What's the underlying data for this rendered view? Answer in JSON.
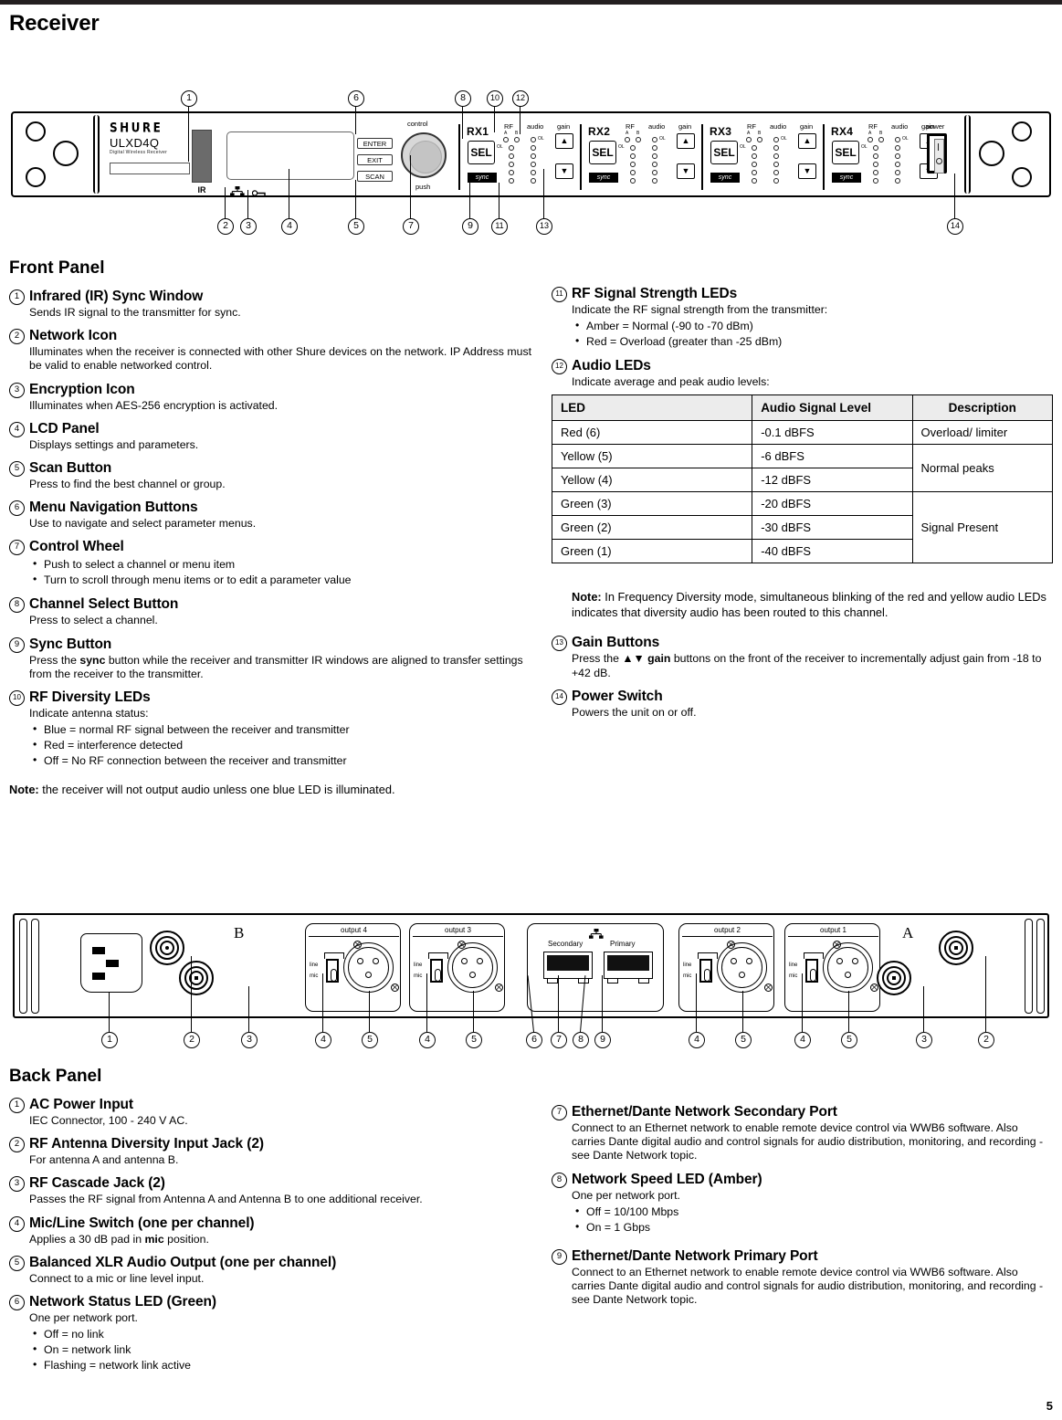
{
  "page": {
    "title": "Receiver",
    "number": "5"
  },
  "front_diagram": {
    "brand": "SHURE",
    "model": "ULXD4Q",
    "subtitle": "Digital Wireless Receiver",
    "ir_label": "IR",
    "control_label": "control",
    "push_label": "push",
    "menu_buttons": [
      "ENTER",
      "EXIT",
      "SCAN"
    ],
    "channels": [
      {
        "name": "RX1",
        "sel": "SEL",
        "sync": "sync"
      },
      {
        "name": "RX2",
        "sel": "SEL",
        "sync": "sync"
      },
      {
        "name": "RX3",
        "sel": "SEL",
        "sync": "sync"
      },
      {
        "name": "RX4",
        "sel": "SEL",
        "sync": "sync"
      }
    ],
    "group_labels": {
      "rf": "RF",
      "audio": "audio",
      "gain": "gain",
      "a": "A",
      "b": "B",
      "ol": "OL"
    },
    "power_label": "power",
    "callouts_top": [
      "1",
      "6",
      "8",
      "10",
      "12"
    ],
    "callouts_bottom": [
      "2",
      "3",
      "4",
      "5",
      "7",
      "9",
      "11",
      "13",
      "14"
    ]
  },
  "front_panel": {
    "heading": "Front Panel",
    "items_left": [
      {
        "num": "1",
        "title": "Infrared (IR) Sync Window",
        "body": "Sends IR signal to the transmitter for sync."
      },
      {
        "num": "2",
        "title": "Network Icon",
        "body": "Illuminates when the receiver is connected with other Shure devices on the network. IP Address must be valid to enable networked control."
      },
      {
        "num": "3",
        "title": "Encryption Icon",
        "body": "Illuminates when AES-256 encryption is activated."
      },
      {
        "num": "4",
        "title": "LCD Panel",
        "body": "Displays settings and parameters."
      },
      {
        "num": "5",
        "title": "Scan Button",
        "body": "Press to find the best channel or group."
      },
      {
        "num": "6",
        "title": "Menu Navigation Buttons",
        "body": "Use to navigate and select parameter menus."
      },
      {
        "num": "7",
        "title": "Control Wheel",
        "bullets": [
          "Push to select a channel or menu item",
          "Turn to scroll through menu items or to edit a parameter value"
        ]
      },
      {
        "num": "8",
        "title": "Channel Select Button",
        "body": "Press to select a channel."
      },
      {
        "num": "9",
        "title": "Sync Button",
        "body_pre": "Press the ",
        "body_bold": "sync",
        "body_post": " button while the receiver and transmitter IR windows are aligned to transfer settings from the receiver to the transmitter."
      },
      {
        "num": "10",
        "title": "RF Diversity LEDs",
        "body": "Indicate antenna status:",
        "bullets": [
          "Blue = normal RF signal between the receiver and transmitter",
          "Red = interference detected",
          "Off = No RF connection between the receiver and transmitter"
        ]
      }
    ],
    "note_left_bold": "Note:",
    "note_left_text": " the receiver will not output audio unless one blue LED is illuminated.",
    "items_right": [
      {
        "num": "11",
        "title": "RF Signal Strength LEDs",
        "body": "Indicate the RF signal strength from the transmitter:",
        "bullets": [
          "Amber = Normal (-90 to -70 dBm)",
          "Red = Overload (greater than -25 dBm)"
        ]
      },
      {
        "num": "12",
        "title": "Audio LEDs",
        "body": "Indicate average and peak audio levels:"
      }
    ],
    "led_table": {
      "headers": [
        "LED",
        "Audio Signal Level",
        "Description"
      ],
      "rows": [
        {
          "led": "Red (6)",
          "level": "-0.1 dBFS"
        },
        {
          "led": "Yellow (5)",
          "level": "-6 dBFS"
        },
        {
          "led": "Yellow (4)",
          "level": "-12 dBFS"
        },
        {
          "led": "Green (3)",
          "level": "-20 dBFS"
        },
        {
          "led": "Green (2)",
          "level": "-30 dBFS"
        },
        {
          "led": "Green (1)",
          "level": "-40 dBFS"
        }
      ],
      "descriptions": [
        "Overload/ limiter",
        "Normal peaks",
        "Signal Present"
      ]
    },
    "note_right_bold": "Note:",
    "note_right_text": " In Frequency Diversity mode, simultaneous blinking of the red and yellow audio LEDs indicates that diversity audio has been routed to this channel.",
    "items_right_after": [
      {
        "num": "13",
        "title": "Gain Buttons",
        "body_pre": "Press the ",
        "body_bold": "▲▼ gain",
        "body_post": " buttons on the front of the receiver to incrementally adjust gain from -18 to +42 dB."
      },
      {
        "num": "14",
        "title": "Power Switch",
        "body": "Powers the unit on or off."
      }
    ]
  },
  "back_diagram": {
    "letter_b": "B",
    "letter_a": "A",
    "outputs": [
      "output 4",
      "output 3",
      "output 2",
      "output 1"
    ],
    "switch_labels": {
      "line": "line",
      "mic": "mic"
    },
    "network_labels": {
      "secondary": "Secondary",
      "primary": "Primary"
    },
    "callouts": [
      "1",
      "2",
      "3",
      "4",
      "5",
      "4",
      "5",
      "6",
      "7",
      "8",
      "9",
      "4",
      "5",
      "4",
      "5",
      "3",
      "2"
    ]
  },
  "back_panel": {
    "heading": "Back Panel",
    "items_left": [
      {
        "num": "1",
        "title": "AC Power Input",
        "body": "IEC Connector, 100 - 240 V AC."
      },
      {
        "num": "2",
        "title": "RF Antenna Diversity Input Jack (2)",
        "body": "For antenna A and antenna B."
      },
      {
        "num": "3",
        "title": "RF Cascade Jack (2)",
        "body": "Passes the RF signal from Antenna A and Antenna B to one additional receiver."
      },
      {
        "num": "4",
        "title": "Mic/Line Switch (one per channel)",
        "body_pre": "Applies a 30 dB pad in ",
        "body_bold": "mic",
        "body_post": " position."
      },
      {
        "num": "5",
        "title": "Balanced XLR Audio Output (one per channel)",
        "body": "Connect to a mic or line level input."
      },
      {
        "num": "6",
        "title": "Network Status LED (Green)",
        "body": "One per network port.",
        "bullets": [
          "Off = no link",
          "On = network link",
          "Flashing = network link active"
        ]
      }
    ],
    "items_right": [
      {
        "num": "7",
        "title": "Ethernet/Dante Network Secondary Port",
        "body": "Connect to an Ethernet network to enable remote device control via WWB6 software. Also carries Dante digital audio and control signals for audio distribution, monitoring, and recording - see Dante Network topic."
      },
      {
        "num": "8",
        "title": "Network Speed LED (Amber)",
        "body": "One per network port.",
        "bullets": [
          "Off = 10/100 Mbps",
          "On = 1 Gbps"
        ]
      },
      {
        "num": "9",
        "title": "Ethernet/Dante Network Primary Port",
        "body": "Connect to an Ethernet network to enable remote device control via WWB6 software. Also carries Dante digital audio and control signals for audio distribution, monitoring, and recording - see Dante Network topic."
      }
    ]
  }
}
